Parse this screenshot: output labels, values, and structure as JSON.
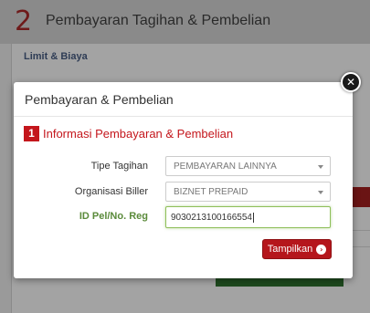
{
  "background": {
    "step_number": "2",
    "step_title": "Pembayaran Tagihan & Pembelian",
    "card_title": "Limit & Biaya"
  },
  "modal": {
    "title": "Pembayaran & Pembelian",
    "close_icon": "close-icon",
    "section": {
      "number": "1",
      "title": "Informasi Pembayaran & Pembelian"
    },
    "fields": {
      "tipe_tagihan": {
        "label": "Tipe Tagihan",
        "value": "PEMBAYARAN LAINNYA"
      },
      "organisasi_biller": {
        "label": "Organisasi Biller",
        "value": "BIZNET PREPAID"
      },
      "id_pel": {
        "label": "ID Pel/No. Reg",
        "value": "9030213100166554"
      }
    },
    "submit_label": "Tampilkan",
    "submit_icon": "arrow-right-circle-icon"
  },
  "colors": {
    "accent_red": "#c4161c",
    "button_red": "#b5161c",
    "label_green": "#5a8a3a"
  }
}
